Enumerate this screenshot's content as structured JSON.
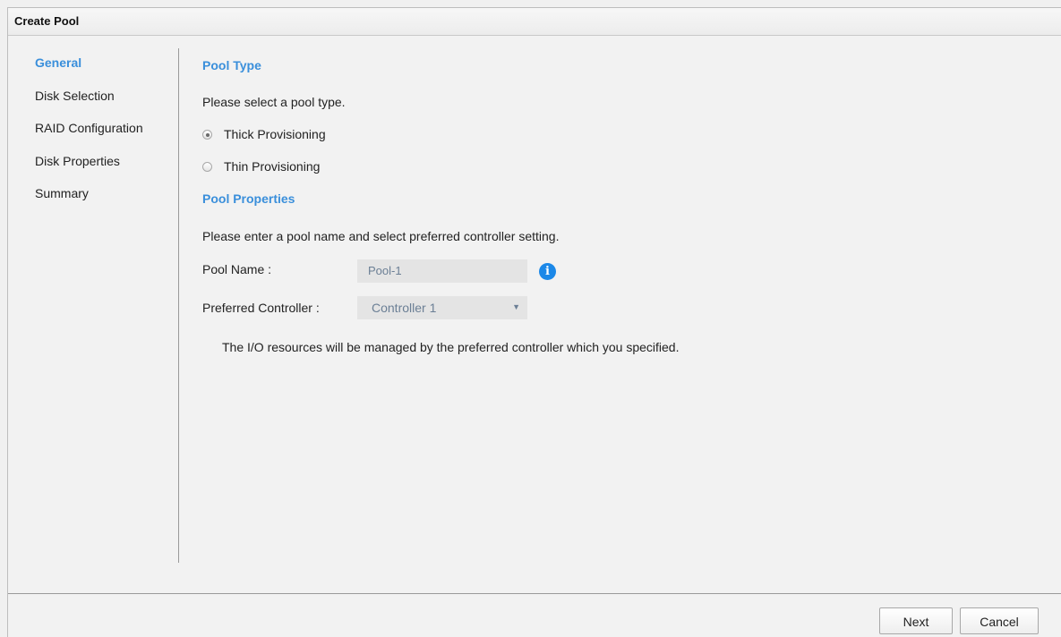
{
  "window": {
    "title": "Create Pool"
  },
  "sidebar": {
    "items": [
      {
        "label": "General"
      },
      {
        "label": "Disk Selection"
      },
      {
        "label": "RAID Configuration"
      },
      {
        "label": "Disk Properties"
      },
      {
        "label": "Summary"
      }
    ],
    "active_index": 0
  },
  "pool_type": {
    "title": "Pool Type",
    "instruction": "Please select a pool type.",
    "options": [
      {
        "label": "Thick Provisioning",
        "checked": true
      },
      {
        "label": "Thin Provisioning",
        "checked": false
      }
    ]
  },
  "pool_properties": {
    "title": "Pool Properties",
    "instruction": "Please enter a pool name and select preferred controller setting.",
    "pool_name_label": "Pool Name :",
    "pool_name_value": "Pool-1",
    "controller_label": "Preferred Controller :",
    "controller_value": "Controller 1",
    "note": "The I/O resources will be managed by the preferred controller which you specified."
  },
  "icons": {
    "info": "info-icon",
    "dropdown": "chevron-down-icon"
  },
  "footer": {
    "next_label": "Next",
    "cancel_label": "Cancel"
  },
  "colors": {
    "accent": "#3a8fdb",
    "info": "#1b88e8",
    "field_bg": "#e4e4e4"
  }
}
